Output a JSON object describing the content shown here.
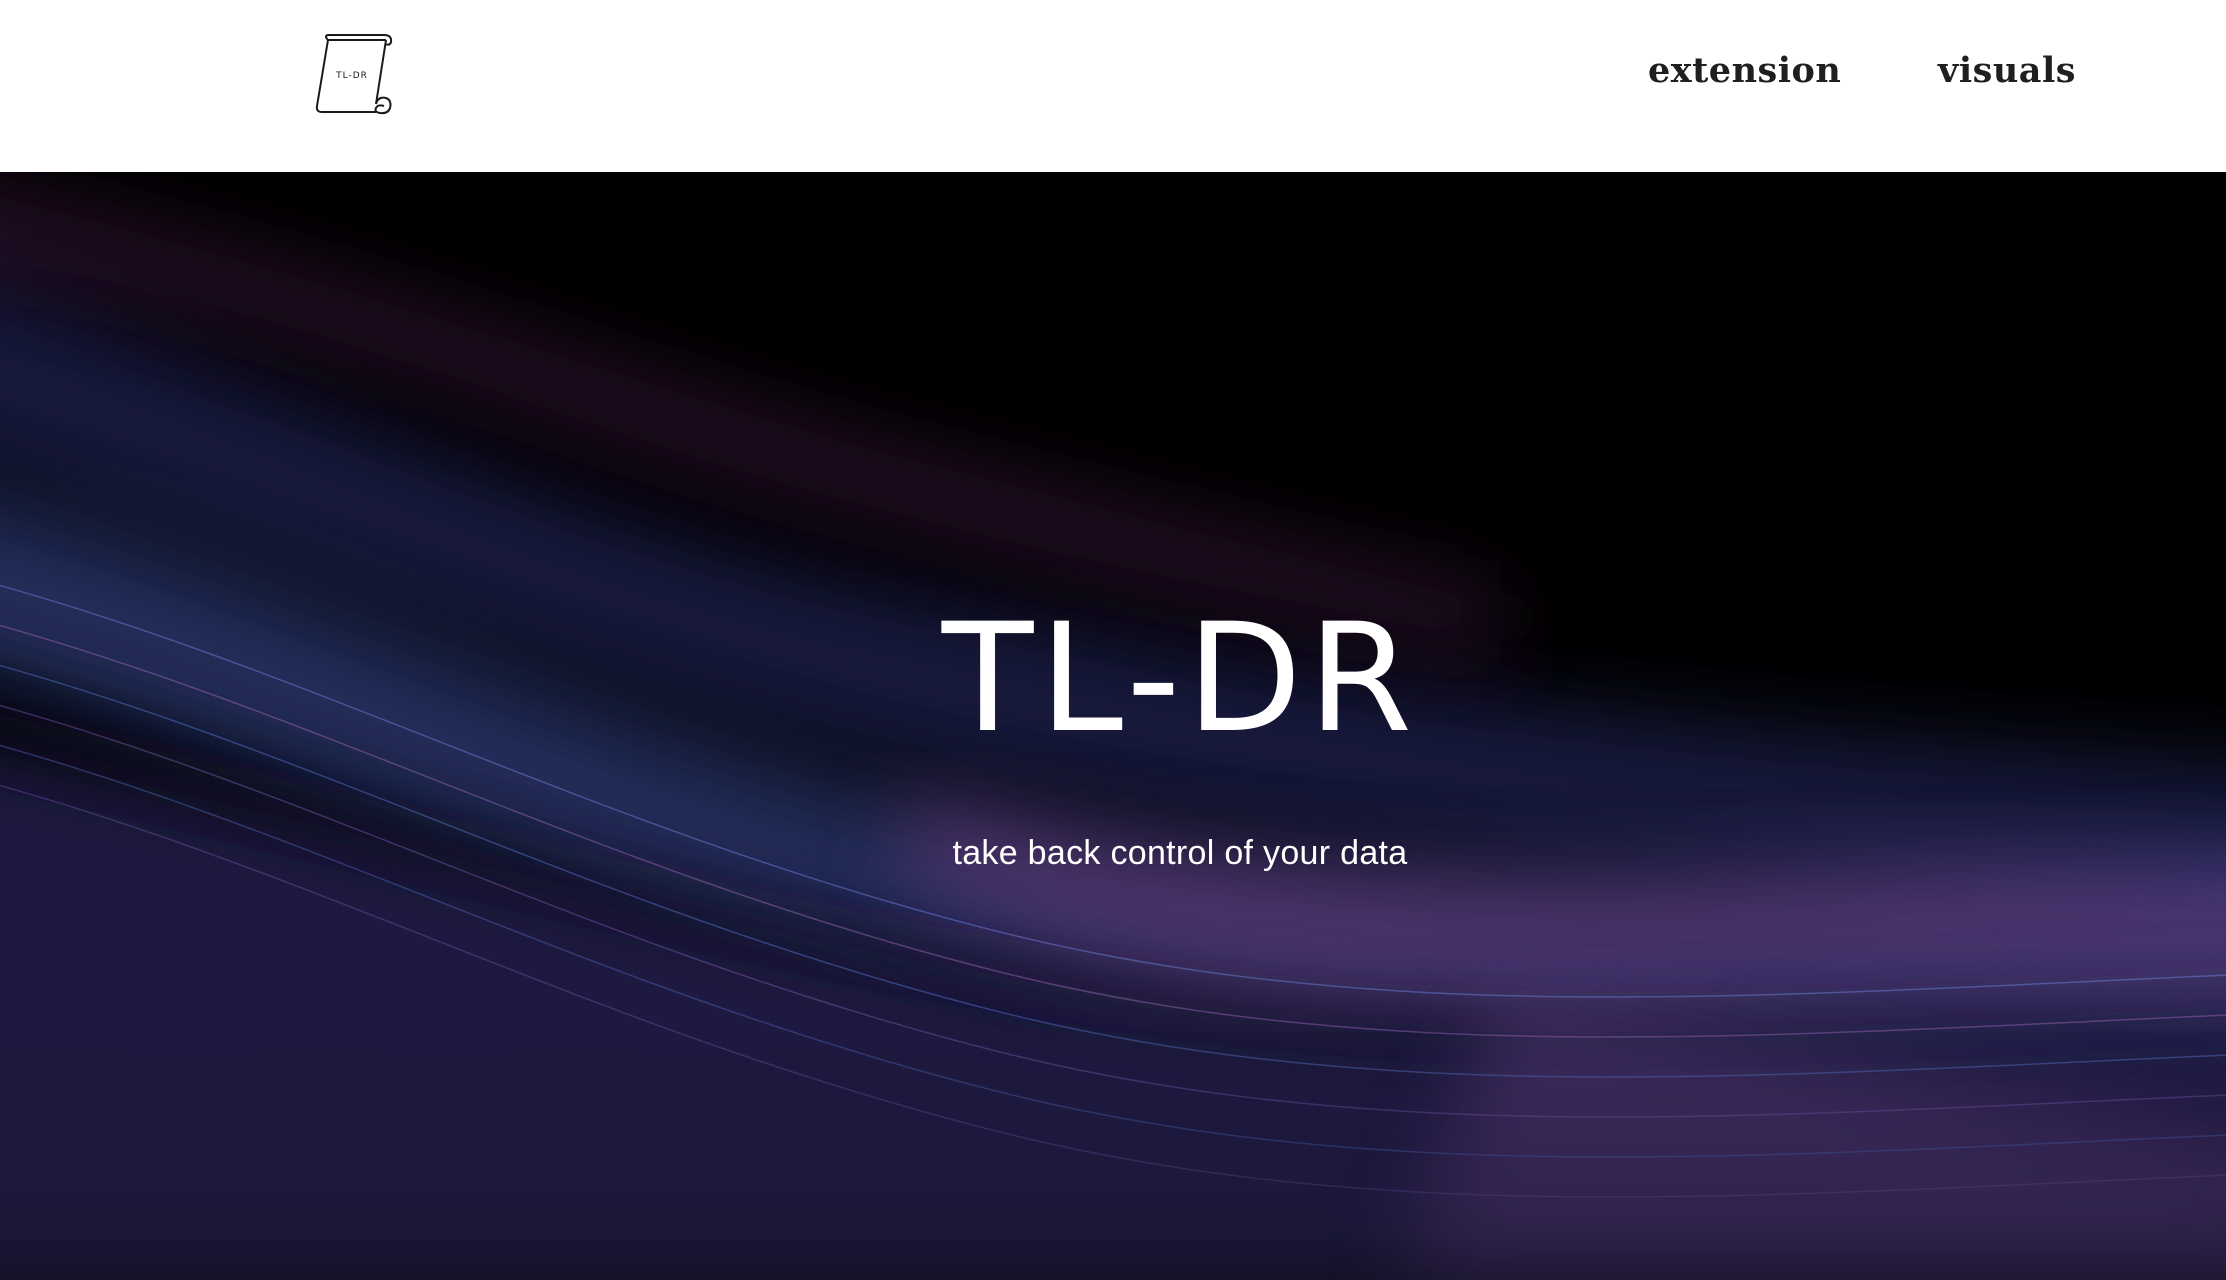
{
  "logo": {
    "text": "TL-DR"
  },
  "nav": {
    "extension_label": "extension",
    "visuals_label": "visuals"
  },
  "hero": {
    "title": "TL-DR",
    "subtitle": "take back control of your data"
  },
  "colors": {
    "header_bg": "#ffffff",
    "hero_bg": "#000000",
    "nav_text": "#1f1f1f",
    "wave_blue": "#3a5fae",
    "wave_purple": "#8a4a9c"
  }
}
